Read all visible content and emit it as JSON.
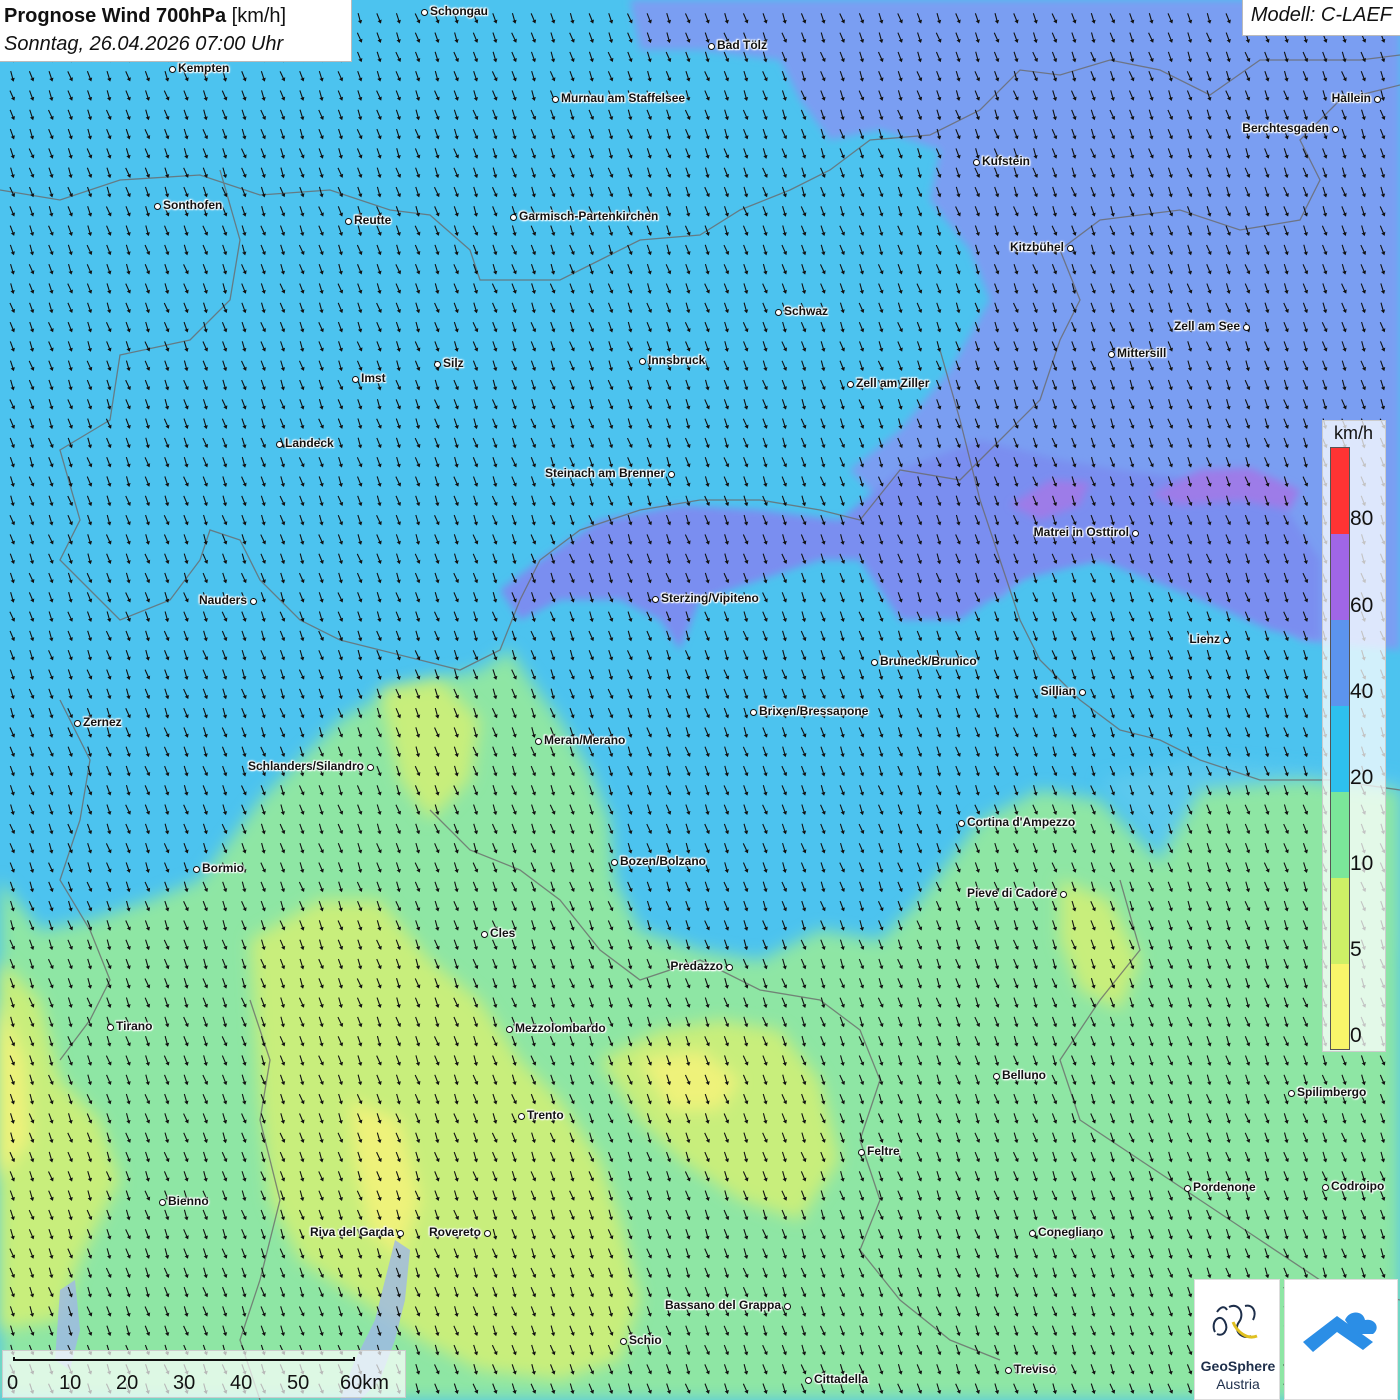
{
  "header": {
    "title_bold": "Prognose Wind 700hPa",
    "title_unit": "[km/h]",
    "datetime": "Sonntag, 26.04.2026 07:00 Uhr",
    "model": "Modell: C-LAEF"
  },
  "legend": {
    "unit": "km/h",
    "ticks": [
      "80",
      "60",
      "40",
      "20",
      "10",
      "5",
      "0"
    ],
    "colors": [
      "#ff3333",
      "#a066e6",
      "#5c94ee",
      "#2ec0ee",
      "#7be69a",
      "#cdf066",
      "#f9f56a"
    ]
  },
  "scale": {
    "labels": [
      "0",
      "10",
      "20",
      "30",
      "40",
      "50",
      "60km"
    ]
  },
  "branding": {
    "logo_text_1": "GeoSphere",
    "logo_text_2": "Austria",
    "logo_accent": "#2b8ee6"
  },
  "wind": {
    "direction": "north-northwest",
    "arrow_icon": "wind-arrow-icon"
  },
  "cities": [
    {
      "name": "Schongau",
      "key": "schongau"
    },
    {
      "name": "Bad Tölz",
      "key": "bad-toelz"
    },
    {
      "name": "Kempten",
      "key": "kempten"
    },
    {
      "name": "Murnau am Staffelsee",
      "key": "murnau"
    },
    {
      "name": "Hallein",
      "key": "hallein"
    },
    {
      "name": "Berchtesgaden",
      "key": "berchtesgaden"
    },
    {
      "name": "Kufstein",
      "key": "kufstein"
    },
    {
      "name": "Sonthofen",
      "key": "sonthofen"
    },
    {
      "name": "Reutte",
      "key": "reutte"
    },
    {
      "name": "Garmisch-Partenkirchen",
      "key": "garmisch"
    },
    {
      "name": "Kitzbühel",
      "key": "kitzbuehel"
    },
    {
      "name": "Schwaz",
      "key": "schwaz"
    },
    {
      "name": "Zell am See",
      "key": "zell-am-see"
    },
    {
      "name": "Mittersill",
      "key": "mittersill"
    },
    {
      "name": "Silz",
      "key": "silz"
    },
    {
      "name": "Innsbruck",
      "key": "innsbruck"
    },
    {
      "name": "Imst",
      "key": "imst"
    },
    {
      "name": "Zell am Ziller",
      "key": "zell-am-ziller"
    },
    {
      "name": "Landeck",
      "key": "landeck"
    },
    {
      "name": "Steinach am Brenner",
      "key": "steinach"
    },
    {
      "name": "Matrei in Osttirol",
      "key": "matrei"
    },
    {
      "name": "Nauders",
      "key": "nauders"
    },
    {
      "name": "Sterzing/Vipiteno",
      "key": "sterzing"
    },
    {
      "name": "Lienz",
      "key": "lienz"
    },
    {
      "name": "Bruneck/Brunico",
      "key": "bruneck"
    },
    {
      "name": "Sillian",
      "key": "sillian"
    },
    {
      "name": "Zernez",
      "key": "zernez"
    },
    {
      "name": "Brixen/Bressanone",
      "key": "brixen"
    },
    {
      "name": "Meran/Merano",
      "key": "meran"
    },
    {
      "name": "Schlanders/Silandro",
      "key": "schlanders"
    },
    {
      "name": "Cortina d'Ampezzo",
      "key": "cortina"
    },
    {
      "name": "Bozen/Bolzano",
      "key": "bozen"
    },
    {
      "name": "Bormio",
      "key": "bormio"
    },
    {
      "name": "Pieve di Cadore",
      "key": "pieve"
    },
    {
      "name": "Cles",
      "key": "cles"
    },
    {
      "name": "Predazzo",
      "key": "predazzo"
    },
    {
      "name": "Tirano",
      "key": "tirano"
    },
    {
      "name": "Mezzolombardo",
      "key": "mezzolombardo"
    },
    {
      "name": "Belluno",
      "key": "belluno"
    },
    {
      "name": "Spilimbergo",
      "key": "spilimbergo"
    },
    {
      "name": "Trento",
      "key": "trento"
    },
    {
      "name": "Feltre",
      "key": "feltre"
    },
    {
      "name": "Pordenone",
      "key": "pordenone"
    },
    {
      "name": "Codroipo",
      "key": "codroipo"
    },
    {
      "name": "Bienno",
      "key": "bienno"
    },
    {
      "name": "Riva del Garda",
      "key": "riva"
    },
    {
      "name": "Rovereto",
      "key": "rovereto"
    },
    {
      "name": "Conegliano",
      "key": "conegliano"
    },
    {
      "name": "Bassano del Grappa",
      "key": "bassano"
    },
    {
      "name": "Schio",
      "key": "schio"
    },
    {
      "name": "Treviso",
      "key": "treviso"
    },
    {
      "name": "Cittadella",
      "key": "cittadella"
    }
  ]
}
